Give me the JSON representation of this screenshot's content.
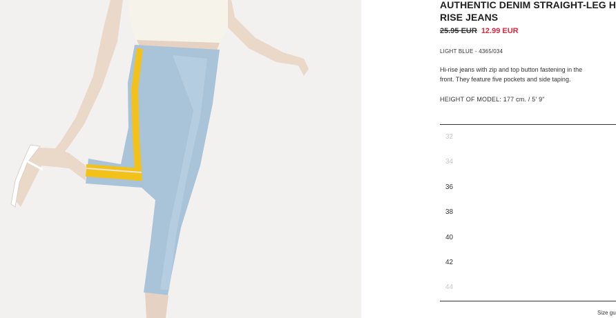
{
  "product": {
    "title_line1": "AUTHENTIC DENIM STRAIGHT-LEG HI-",
    "title_line2": "RISE JEANS",
    "old_price": "25.95 EUR",
    "new_price": "12.99 EUR",
    "color_ref": "LIGHT BLUE - 4365/034",
    "description_line1": "Hi-rise jeans with zip and top button fastening in the",
    "description_line2": "front. They feature five pockets and side taping.",
    "model_height": "HEIGHT OF MODEL: 177 cm. / 5' 9\""
  },
  "sizes": [
    {
      "label": "32",
      "available": false
    },
    {
      "label": "34",
      "available": false
    },
    {
      "label": "36",
      "available": true
    },
    {
      "label": "38",
      "available": true
    },
    {
      "label": "40",
      "available": true
    },
    {
      "label": "42",
      "available": true
    },
    {
      "label": "44",
      "available": false
    }
  ],
  "size_guide_label": "Size guide",
  "colors": {
    "sale_price": "#e0263c",
    "unavailable_size": "#c8c8c8",
    "denim": "#a9c4d9",
    "side_tape": "#f2c21b"
  }
}
